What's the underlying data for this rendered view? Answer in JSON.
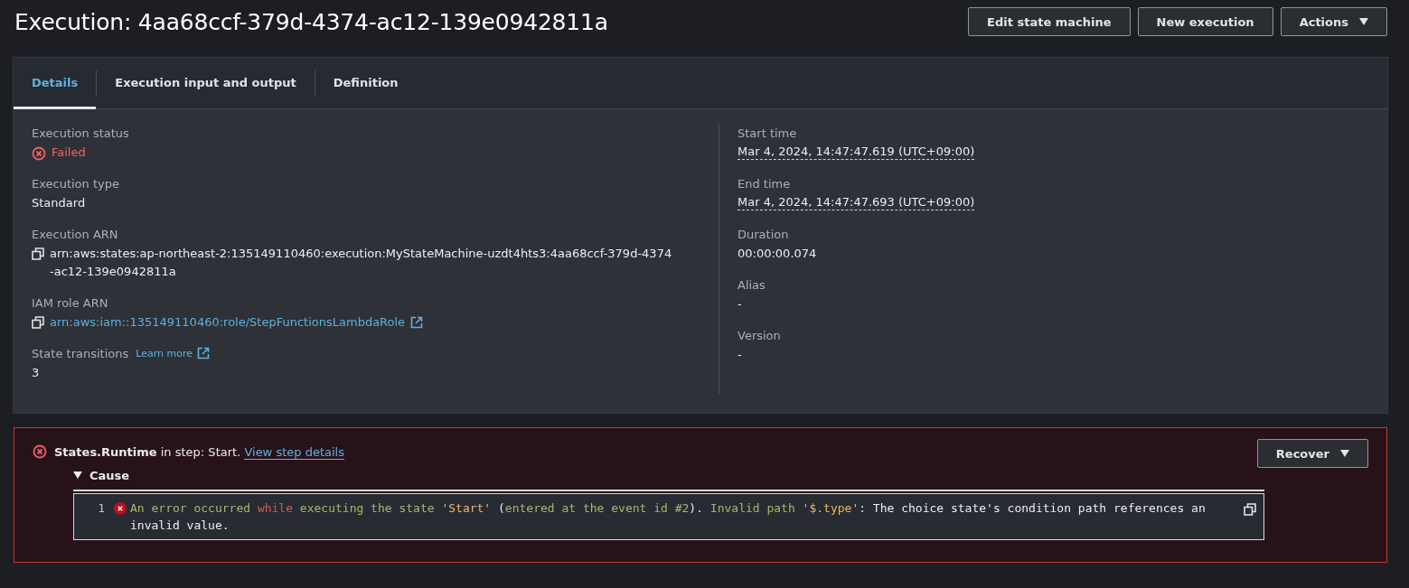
{
  "title": "Execution: 4aa68ccf-379d-4374-ac12-139e0942811a",
  "header_buttons": [
    {
      "label": "Edit state machine",
      "dropdown": false
    },
    {
      "label": "New execution",
      "dropdown": false
    },
    {
      "label": "Actions",
      "dropdown": true
    }
  ],
  "tabs": [
    {
      "label": "Details",
      "selected": true
    },
    {
      "label": "Execution input and output",
      "selected": false
    },
    {
      "label": "Definition",
      "selected": false
    }
  ],
  "details": {
    "left": [
      {
        "label": "Execution status",
        "value": "Failed",
        "kind": "failed"
      },
      {
        "label": "Execution type",
        "value": "Standard",
        "kind": "text"
      },
      {
        "label": "Execution ARN",
        "value": "arn:aws:states:ap-northeast-2:135149110460:execution:MyStateMachine-uzdt4hts3:4aa68ccf-379d-4374-ac12-139e0942811a",
        "kind": "copy"
      },
      {
        "label": "IAM role ARN",
        "value": "arn:aws:iam::135149110460:role/StepFunctionsLambdaRole",
        "kind": "copy_link"
      },
      {
        "label": "State transitions",
        "info_link": "Learn more",
        "value": "3",
        "kind": "text"
      }
    ],
    "right": [
      {
        "label": "Start time",
        "value": "Mar 4, 2024, 14:47:47.619 (UTC+09:00)",
        "kind": "timestamp"
      },
      {
        "label": "End time",
        "value": "Mar 4, 2024, 14:47:47.693 (UTC+09:00)",
        "kind": "timestamp"
      },
      {
        "label": "Duration",
        "value": "00:00:00.074",
        "kind": "text"
      },
      {
        "label": "Alias",
        "value": "-",
        "kind": "text"
      },
      {
        "label": "Version",
        "value": "-",
        "kind": "text"
      }
    ]
  },
  "error": {
    "message": "**States.Runtime** in step: Start.",
    "link": "View step details",
    "button": {
      "label": "Recover",
      "dropdown": true
    },
    "cause": {
      "label": "Cause",
      "expanded": true,
      "line_number": "1",
      "tokens": [
        {
          "text": "An error occurred ",
          "kind": "word"
        },
        {
          "text": "while",
          "kind": "keyword"
        },
        {
          "text": " executing the state ",
          "kind": "word"
        },
        {
          "text": "'Start'",
          "kind": "string"
        },
        {
          "text": " (",
          "kind": "plain"
        },
        {
          "text": "entered at the event id #2",
          "kind": "word"
        },
        {
          "text": "). ",
          "kind": "plain"
        },
        {
          "text": "Invalid path ",
          "kind": "word"
        },
        {
          "text": "'$.type'",
          "kind": "string"
        },
        {
          "text": ": The choice state's condition path references an invalid value.",
          "kind": "plain"
        }
      ]
    }
  }
}
